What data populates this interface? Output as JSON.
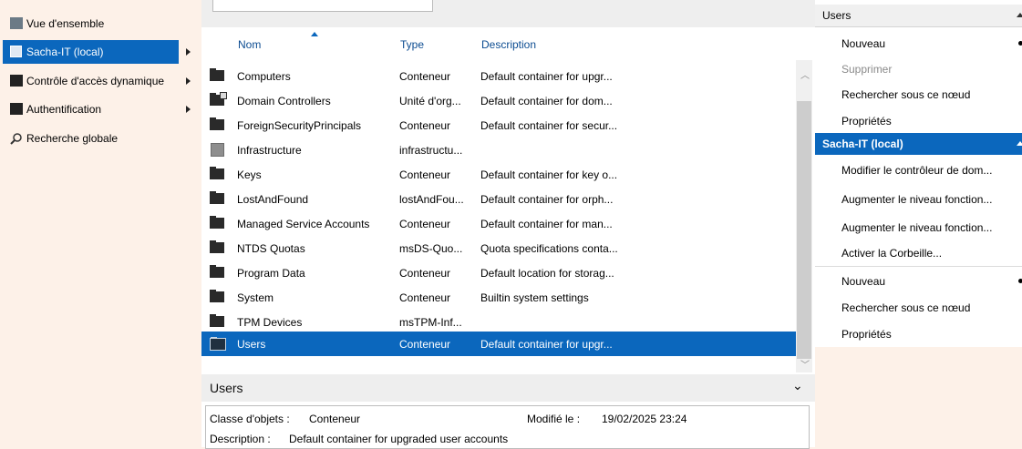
{
  "nav": {
    "items": [
      {
        "label": "Vue d'ensemble",
        "icon": "overview-grid-icon"
      },
      {
        "label": "Sacha-IT (local)",
        "icon": "domain-icon"
      },
      {
        "label": "Contrôle d'accès dynamique",
        "icon": "folder-icon"
      },
      {
        "label": "Authentification",
        "icon": "folder-icon"
      },
      {
        "label": "Recherche globale",
        "icon": "search-icon"
      }
    ]
  },
  "list": {
    "columns": {
      "name": "Nom",
      "type": "Type",
      "description": "Description"
    },
    "rows": [
      {
        "name": "Computers",
        "type": "Conteneur",
        "description": "Default container for upgr..."
      },
      {
        "name": "Domain Controllers",
        "type": "Unité d'org...",
        "description": "Default container for dom..."
      },
      {
        "name": "ForeignSecurityPrincipals",
        "type": "Conteneur",
        "description": "Default container for secur..."
      },
      {
        "name": "Infrastructure",
        "type": "infrastructu...",
        "description": ""
      },
      {
        "name": "Keys",
        "type": "Conteneur",
        "description": "Default container for key o..."
      },
      {
        "name": "LostAndFound",
        "type": "lostAndFou...",
        "description": "Default container for orph..."
      },
      {
        "name": "Managed Service Accounts",
        "type": "Conteneur",
        "description": "Default container for man..."
      },
      {
        "name": "NTDS Quotas",
        "type": "msDS-Quo...",
        "description": "Quota specifications conta..."
      },
      {
        "name": "Program Data",
        "type": "Conteneur",
        "description": "Default location for storag..."
      },
      {
        "name": "System",
        "type": "Conteneur",
        "description": "Builtin system settings"
      },
      {
        "name": "TPM Devices",
        "type": "msTPM-Inf...",
        "description": ""
      },
      {
        "name": "Users",
        "type": "Conteneur",
        "description": "Default container for upgr..."
      }
    ],
    "selected_row": "Users"
  },
  "detail": {
    "title": "Users",
    "class_label": "Classe d'objets :",
    "class_value": "Conteneur",
    "modified_label": "Modifié le :",
    "modified_value": "19/02/2025 23:24",
    "description_label": "Description :",
    "description_value": "Default container for upgraded user accounts"
  },
  "actions": {
    "section1": {
      "title": "Users",
      "items": [
        "Nouveau",
        "Supprimer",
        "Rechercher sous ce nœud",
        "Propriétés"
      ]
    },
    "section2": {
      "title": "Sacha-IT (local)",
      "items": [
        "Modifier le contrôleur de dom...",
        "Augmenter le niveau fonction...",
        "Augmenter le niveau fonction...",
        "Activer la Corbeille...",
        "Nouveau",
        "Rechercher sous ce nœud",
        "Propriétés"
      ]
    }
  },
  "colors": {
    "accent": "#0b67bd",
    "background": "#fdf1e8"
  }
}
